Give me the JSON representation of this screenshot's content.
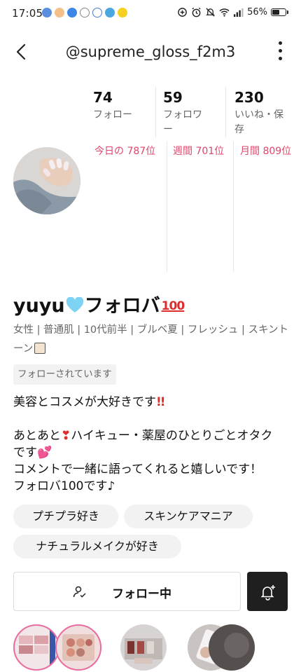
{
  "status": {
    "time": "17:05",
    "battery": "56%"
  },
  "header": {
    "username": "@supreme_gloss_f2m3"
  },
  "stats": {
    "following_count": "74",
    "following_label": "フォロー",
    "followers_count": "59",
    "followers_label": "フォロワー",
    "likes_count": "230",
    "likes_label": "いいね・保存"
  },
  "ranks": {
    "daily": "今日の 787位",
    "weekly": "週間 701位",
    "monthly": "月間 809位"
  },
  "profile": {
    "name_prefix": "yuyu",
    "name_suffix": "フォロバ",
    "hundred": "100",
    "attributes": "女性 | 普通肌 | 10代前半 | ブルベ夏 | フレッシュ | スキントーン",
    "follows_you": "フォローされています",
    "bio_line1": "美容とコスメが大好きです",
    "bio_line1_emoji": "!!",
    "bio_line2a": "あとあと",
    "bio_line2_heart": "❣",
    "bio_line2b": "ハイキュー・薬屋のひとりごとオタク",
    "bio_line3a": "です",
    "bio_line3_hearts": "💕",
    "bio_line4": "コメントで一緒に語ってくれると嬉しいです！",
    "bio_line5": "フォロバ100です♪"
  },
  "tags": [
    "プチプラ好き",
    "スキンケアマニア",
    "ナチュラルメイクが好き"
  ],
  "actions": {
    "follow_label": "フォロー中"
  },
  "icons": {
    "back": "back-arrow-icon",
    "more": "more-vertical-icon",
    "follow": "user-check-icon",
    "bell": "bell-plus-icon"
  },
  "colors": {
    "rank": "#e0456a",
    "bell_button": "#1f1f1f",
    "story_ring": "#e96da0"
  }
}
